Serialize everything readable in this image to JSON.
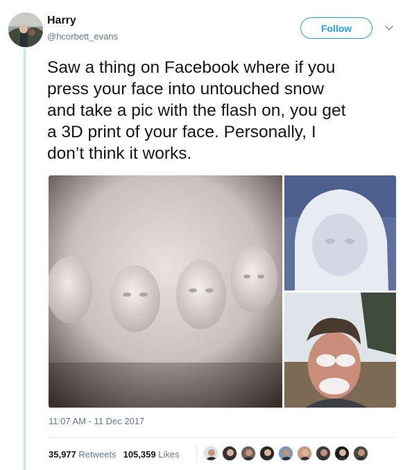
{
  "tweet": {
    "author_name": "Harry",
    "author_handle": "@hcorbett_evans",
    "follow_label": "Follow",
    "text": "Saw a thing on Facebook where if you\npress your face into untouched snow\nand take a pic with the flash on, you get\na 3D print of your face. Personally, I\ndon’t think it works.",
    "timestamp": "11:07 AM - 11 Dec 2017",
    "retweets_count": "35,977",
    "retweets_label": "Retweets",
    "likes_count": "105,359",
    "likes_label": "Likes"
  },
  "icons": {
    "caret": "chevron-down-icon"
  },
  "colors": {
    "accent": "#1da1f2",
    "text": "#14171a",
    "muted": "#657786",
    "thread_line": "#c4e6f8"
  },
  "likers": [
    {
      "name": "liker-avatar-1",
      "bg": "#d9e4ea"
    },
    {
      "name": "liker-avatar-2",
      "bg": "#3a3028"
    },
    {
      "name": "liker-avatar-3",
      "bg": "#6e6256"
    },
    {
      "name": "liker-avatar-4",
      "bg": "#2b2522"
    },
    {
      "name": "liker-avatar-5",
      "bg": "#7c9ab3"
    },
    {
      "name": "liker-avatar-6",
      "bg": "#c79a7d"
    },
    {
      "name": "liker-avatar-7",
      "bg": "#403a39"
    },
    {
      "name": "liker-avatar-8",
      "bg": "#1f1b1b"
    },
    {
      "name": "liker-avatar-9",
      "bg": "#4a4a3a"
    }
  ]
}
